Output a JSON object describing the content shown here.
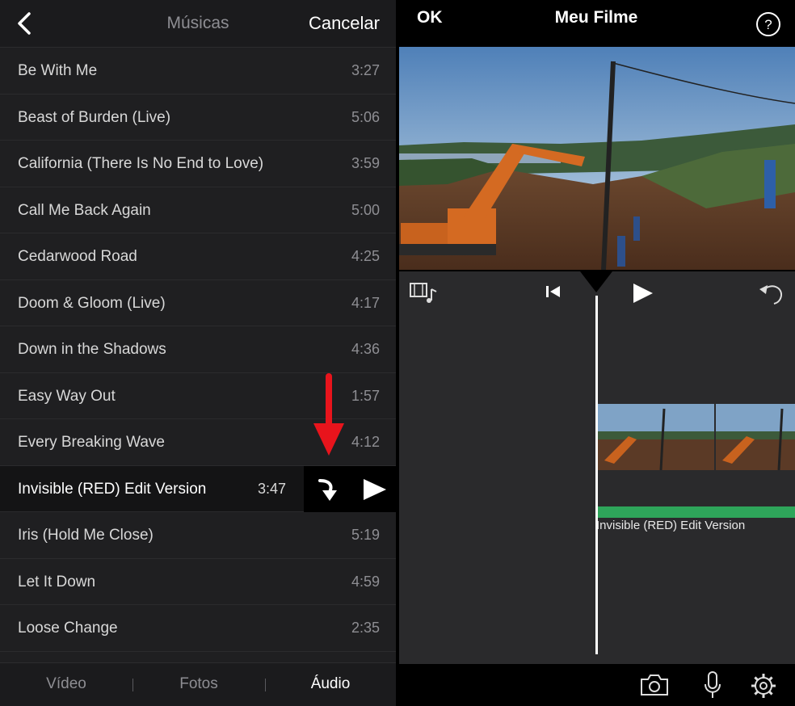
{
  "left_panel": {
    "nav": {
      "title": "Músicas",
      "cancel_label": "Cancelar"
    },
    "songs": [
      {
        "title": "Be With Me",
        "duration": "3:27"
      },
      {
        "title": "Beast of Burden (Live)",
        "duration": "5:06"
      },
      {
        "title": "California (There Is No End to Love)",
        "duration": "3:59"
      },
      {
        "title": "Call Me Back Again",
        "duration": "5:00"
      },
      {
        "title": "Cedarwood Road",
        "duration": "4:25"
      },
      {
        "title": "Doom & Gloom (Live)",
        "duration": "4:17"
      },
      {
        "title": "Down in the Shadows",
        "duration": "4:36"
      },
      {
        "title": "Easy Way Out",
        "duration": "1:57"
      },
      {
        "title": "Every Breaking Wave",
        "duration": "4:12"
      },
      {
        "title": "Invisible (RED) Edit Version",
        "duration": "3:47"
      },
      {
        "title": "Iris (Hold Me Close)",
        "duration": "5:19"
      },
      {
        "title": "Let It Down",
        "duration": "4:59"
      },
      {
        "title": "Loose Change",
        "duration": "2:35"
      }
    ],
    "selected_index": 9,
    "tabs": [
      {
        "label": "Vídeo",
        "active": false
      },
      {
        "label": "Fotos",
        "active": false
      },
      {
        "label": "Áudio",
        "active": true
      }
    ],
    "annotation_color": "#e8141c"
  },
  "right_panel": {
    "nav": {
      "ok_label": "OK",
      "title": "Meu Filme"
    },
    "audio_clip": {
      "label": "Invisible (RED) Edit Version",
      "color": "#2ea55a"
    }
  }
}
